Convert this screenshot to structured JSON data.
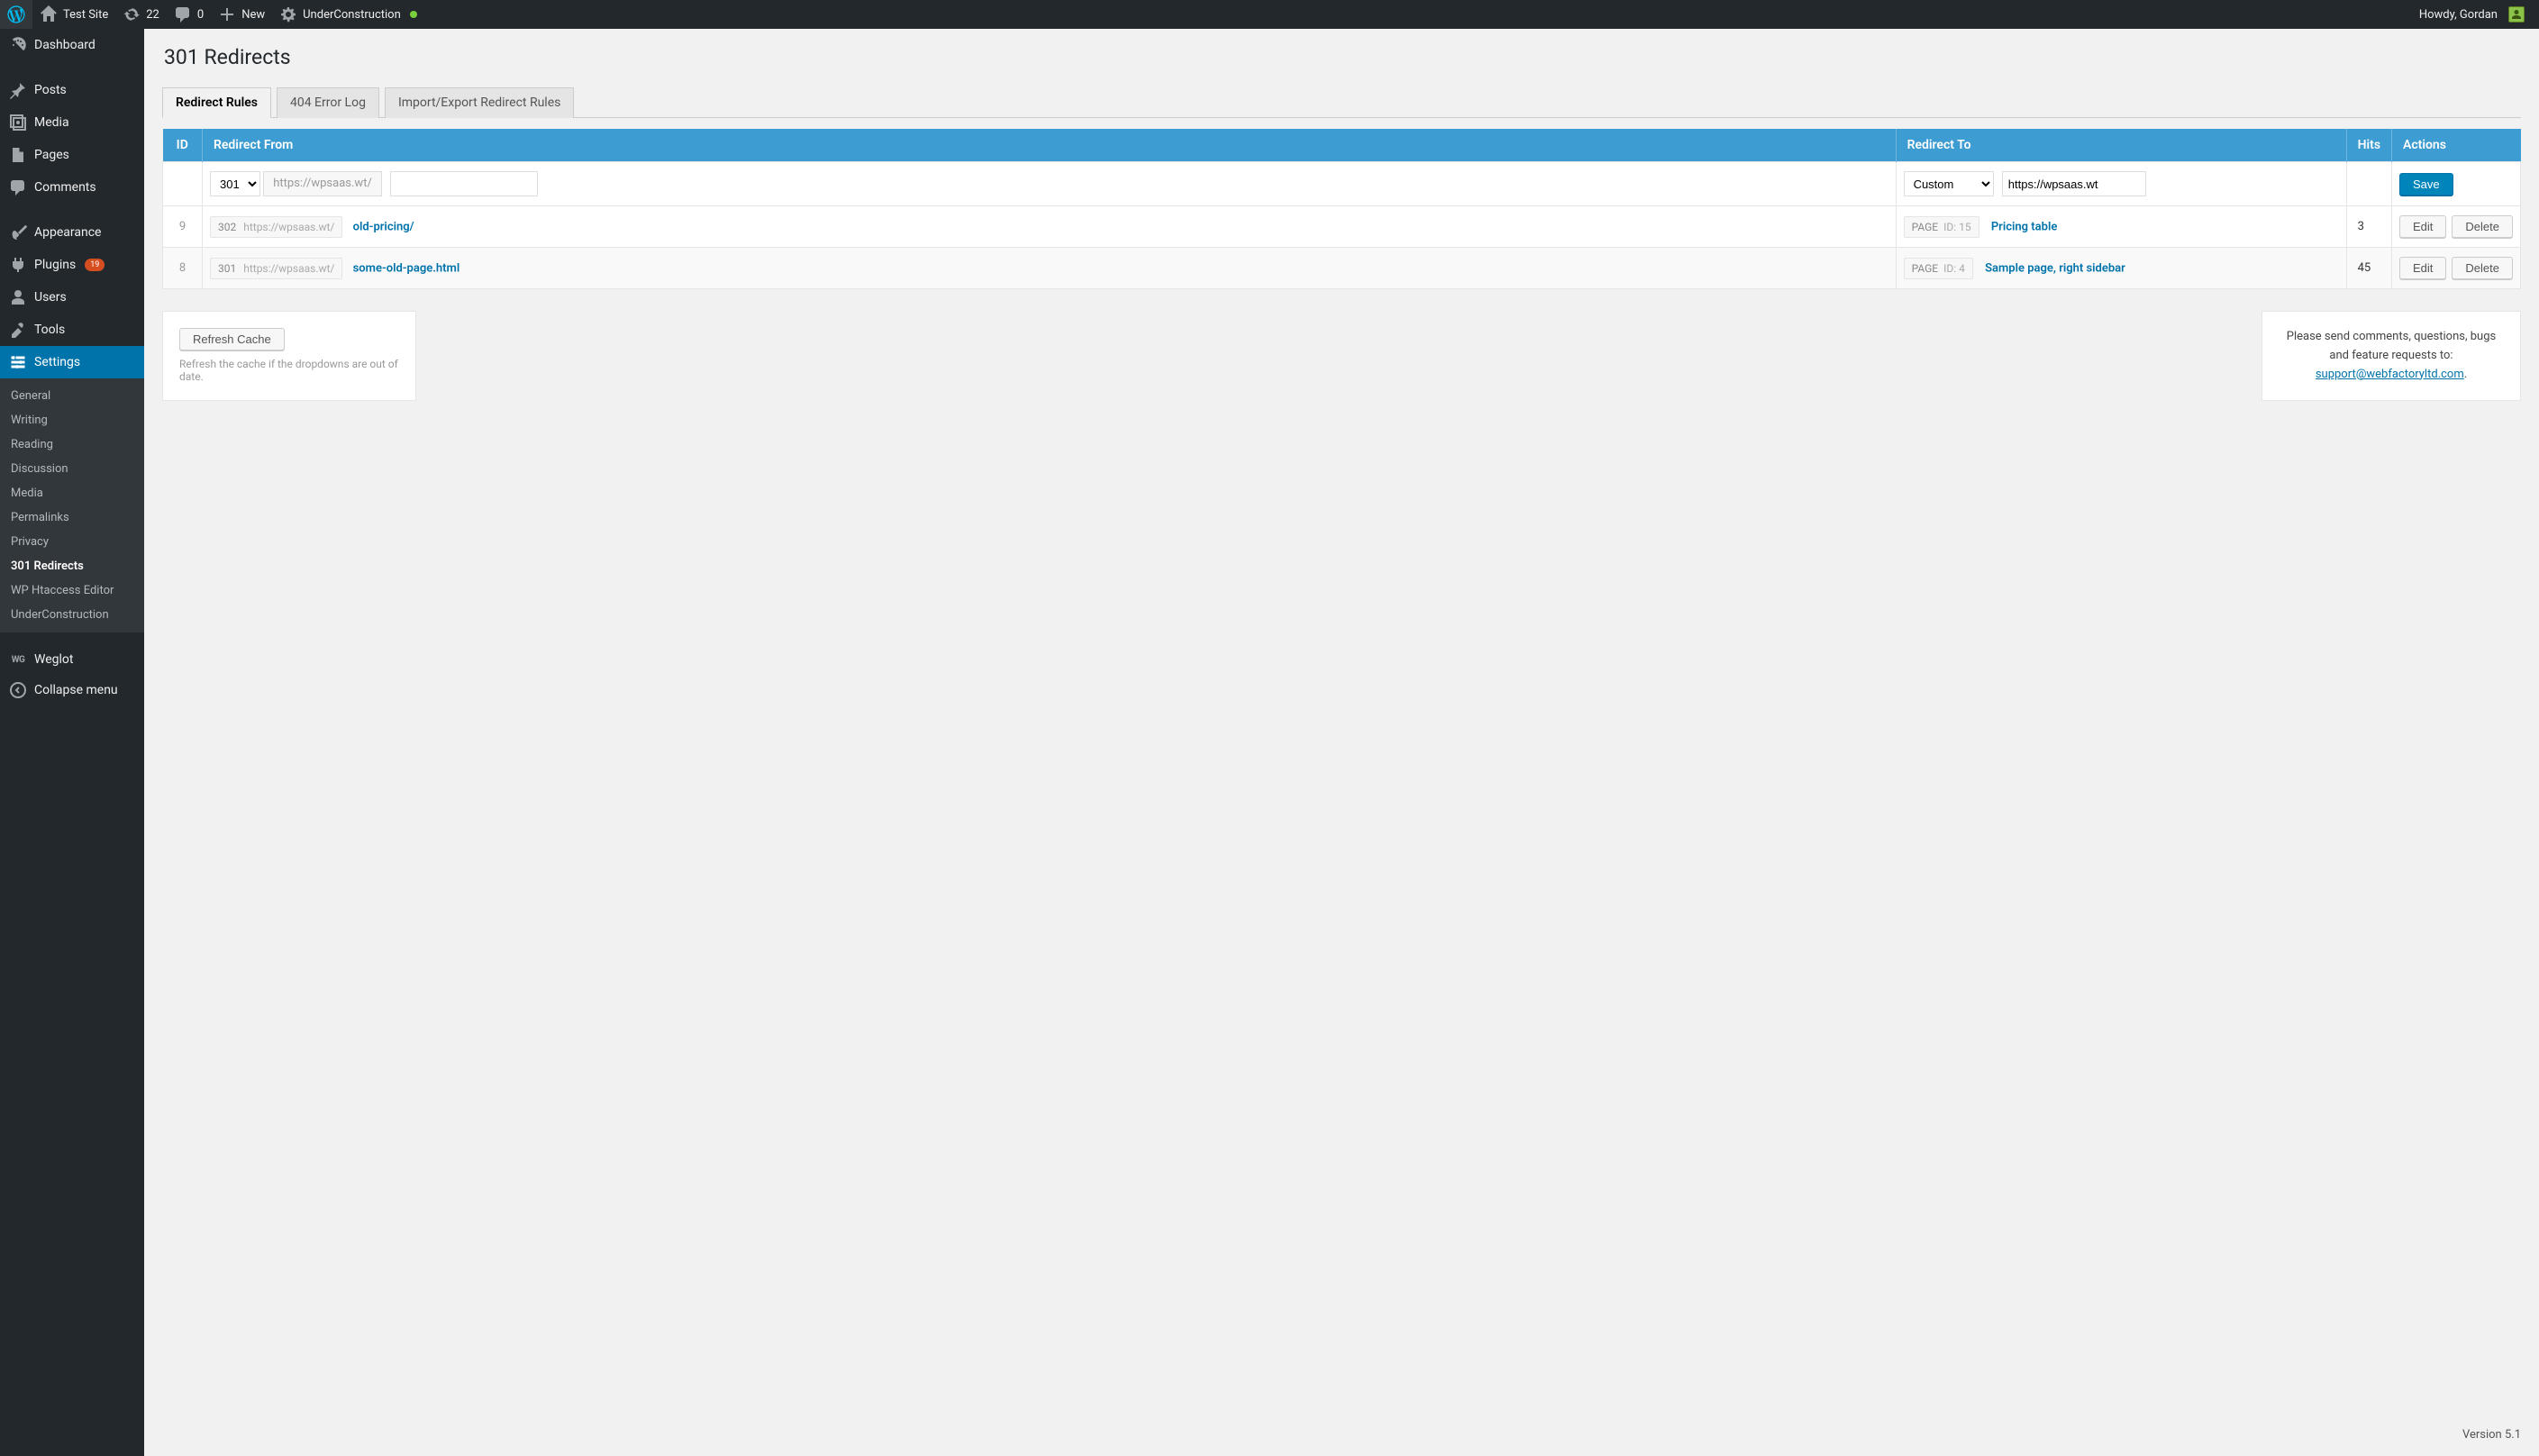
{
  "adminbar": {
    "site_name": "Test Site",
    "updates_count": "22",
    "comments_count": "0",
    "new_label": "New",
    "underconstruction_label": "UnderConstruction",
    "howdy": "Howdy, Gordan"
  },
  "sidebar": {
    "dashboard": "Dashboard",
    "posts": "Posts",
    "media": "Media",
    "pages": "Pages",
    "comments": "Comments",
    "appearance": "Appearance",
    "plugins": "Plugins",
    "plugins_badge": "19",
    "users": "Users",
    "tools": "Tools",
    "settings": "Settings",
    "weglot": "Weglot",
    "collapse": "Collapse menu",
    "submenu": {
      "general": "General",
      "writing": "Writing",
      "reading": "Reading",
      "discussion": "Discussion",
      "media": "Media",
      "permalinks": "Permalinks",
      "privacy": "Privacy",
      "redirects": "301 Redirects",
      "htaccess": "WP Htaccess Editor",
      "underconstruction": "UnderConstruction"
    }
  },
  "page": {
    "title": "301 Redirects",
    "tabs": {
      "rules": "Redirect Rules",
      "errorlog": "404 Error Log",
      "importexport": "Import/Export Redirect Rules"
    },
    "columns": {
      "id": "ID",
      "from": "Redirect From",
      "to": "Redirect To",
      "hits": "Hits",
      "actions": "Actions"
    },
    "form": {
      "code_selected": "301",
      "domain_prefix": "https://wpsaas.wt/",
      "target_selected": "Custom",
      "target_url": "https://wpsaas.wt",
      "save_label": "Save"
    },
    "rows": [
      {
        "id": "9",
        "code": "302",
        "domain": "https://wpsaas.wt/",
        "path": "old-pricing/",
        "target_type": "PAGE",
        "target_id_label": "ID: 15",
        "target_title": "Pricing table",
        "hits": "3",
        "edit_label": "Edit",
        "delete_label": "Delete"
      },
      {
        "id": "8",
        "code": "301",
        "domain": "https://wpsaas.wt/",
        "path": "some-old-page.html",
        "target_type": "PAGE",
        "target_id_label": "ID: 4",
        "target_title": "Sample page, right sidebar",
        "hits": "45",
        "edit_label": "Edit",
        "delete_label": "Delete"
      }
    ],
    "refresh": {
      "button": "Refresh Cache",
      "hint": "Refresh the cache if the dropdowns are out of date."
    },
    "support": {
      "text": "Please send comments, questions, bugs and feature requests to:",
      "email": "support@webfactoryltd.com",
      "period": "."
    }
  },
  "footer": {
    "version": "Version 5.1"
  }
}
